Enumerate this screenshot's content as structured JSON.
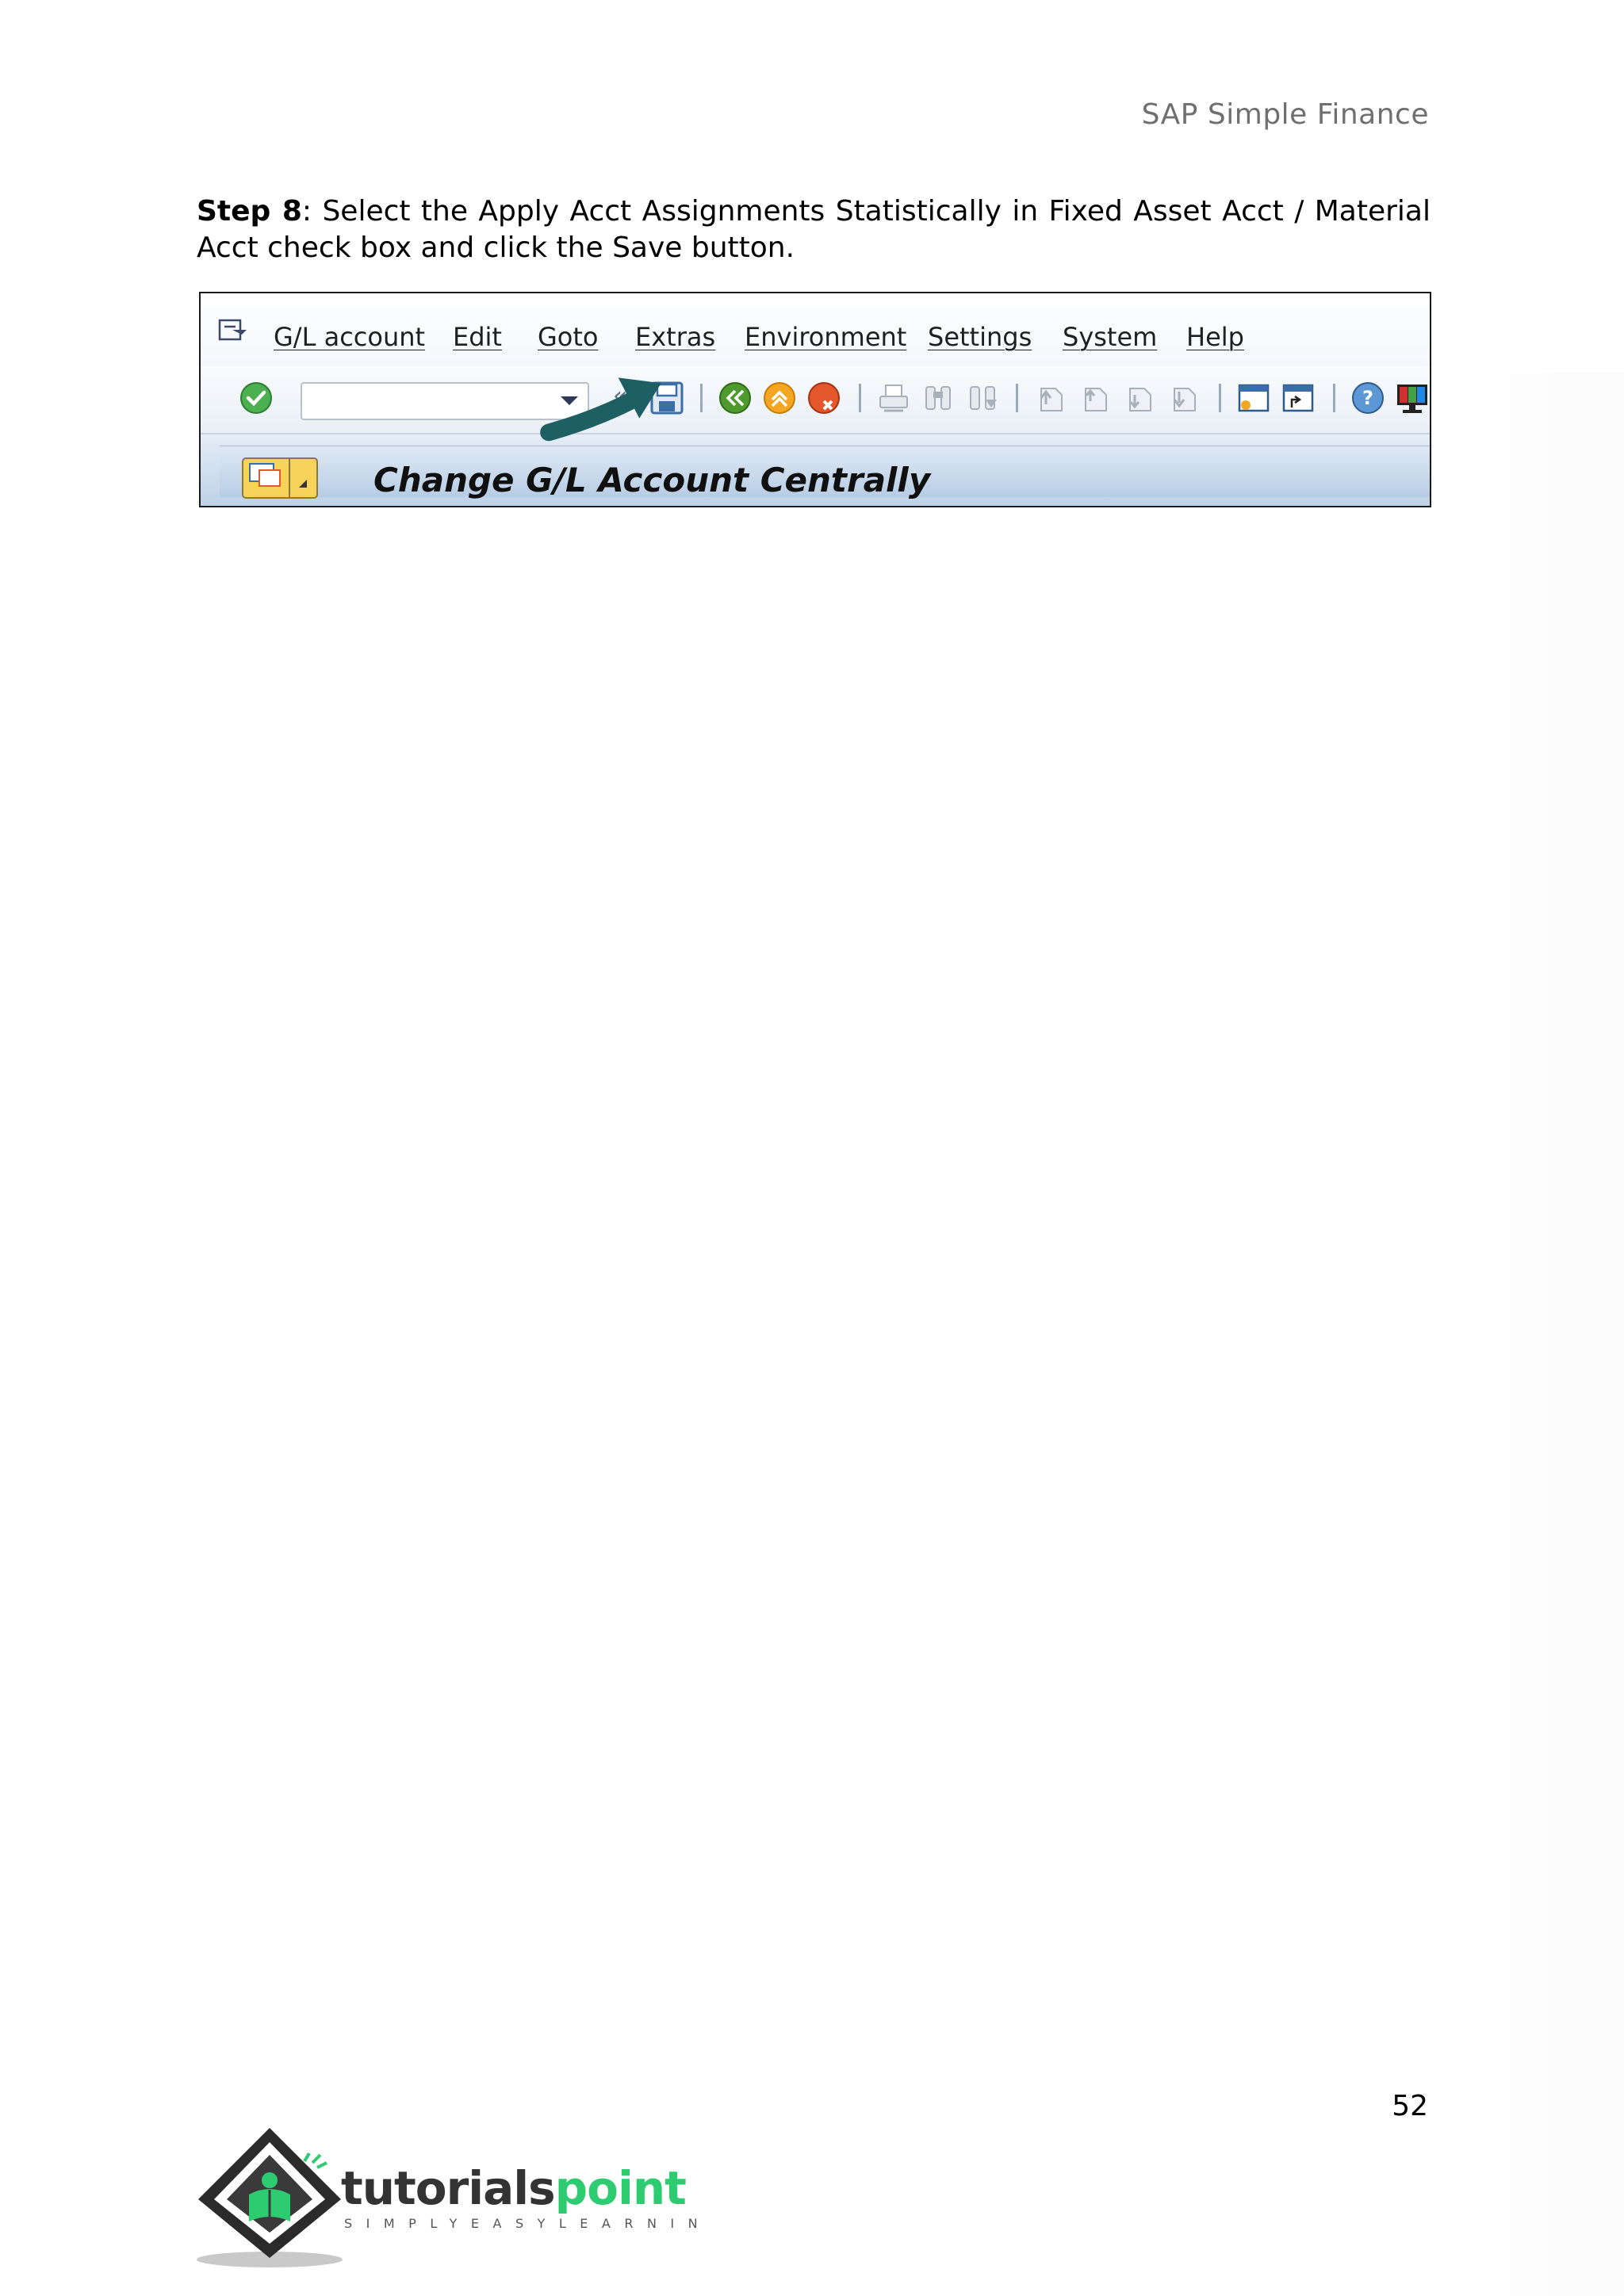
{
  "header": {
    "running_title": "SAP Simple Finance"
  },
  "step": {
    "label": "Step 8",
    "text": ": Select the Apply Acct Assignments Statistically in Fixed Asset Acct / Material Acct check box and click the Save button."
  },
  "sap": {
    "menu": [
      "G/L account",
      "Edit",
      "Goto",
      "Extras",
      "Environment",
      "Settings",
      "System",
      "Help"
    ],
    "command_field": {
      "value": ""
    },
    "toolbar_icons": [
      "enter-icon",
      "save-icon",
      "back-icon",
      "exit-icon",
      "cancel-icon",
      "print-icon",
      "find-icon",
      "find-next-icon",
      "first-page-icon",
      "previous-page-icon",
      "next-page-icon",
      "last-page-icon",
      "create-session-icon",
      "shortcut-icon",
      "help-icon",
      "layout-menu-icon"
    ],
    "title": "Change G/L Account Centrally"
  },
  "footer": {
    "page_number": "52",
    "logo_text": "tutorialspoint",
    "logo_tagline": "SIMPLYEASYLEARNING"
  },
  "colors": {
    "arrow": "#1e5f63",
    "logo_green": "#2ecc71",
    "logo_dark": "#333333"
  }
}
